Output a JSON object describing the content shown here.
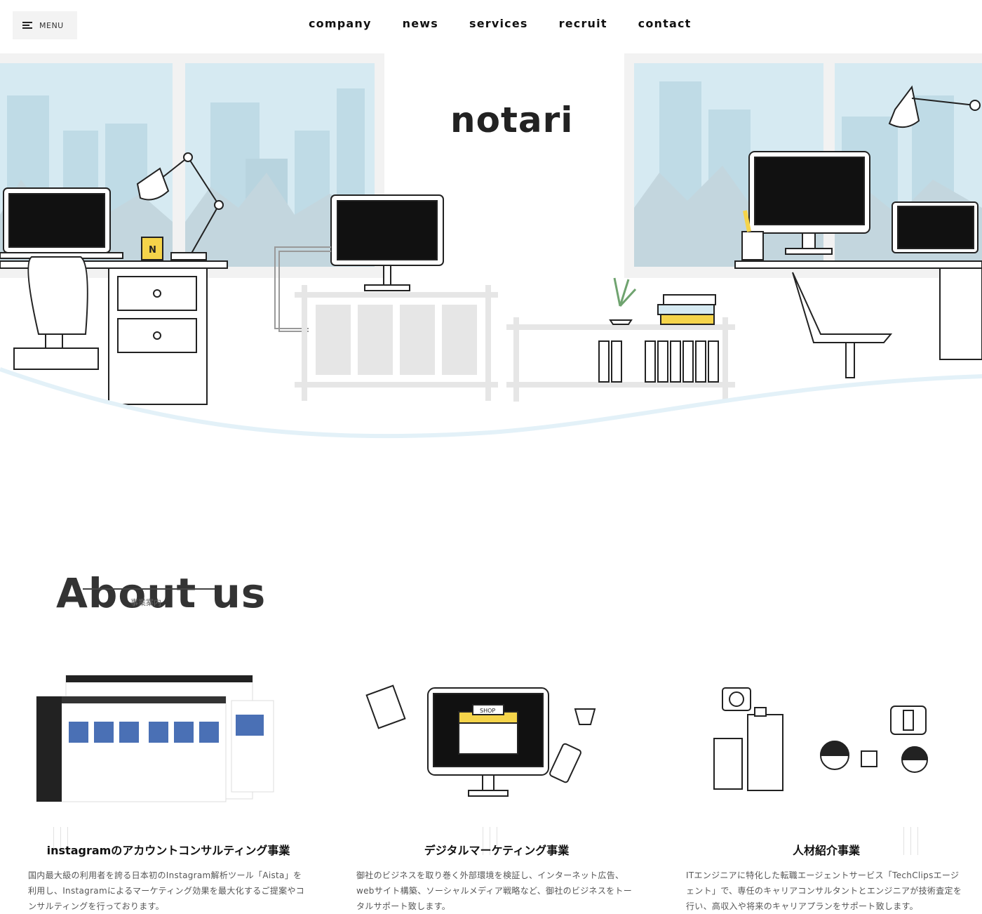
{
  "header": {
    "menu_label": "MENU",
    "nav": [
      "company",
      "news",
      "services",
      "recruit",
      "contact"
    ]
  },
  "hero": {
    "logo": "notari",
    "mug_letter": "N",
    "shop_sign": "SHOP"
  },
  "about": {
    "title": "About us",
    "subtitle": "事業案内"
  },
  "services": [
    {
      "title": "instagramのアカウントコンサルティング事業",
      "desc": "国内最大級の利用者を誇る日本初のInstagram解析ツール「Aista」を利用し、Instagramによるマーケティング効果を最大化するご提案やコンサルティングを行っております。"
    },
    {
      "title": "デジタルマーケティング事業",
      "desc": "御社のビジネスを取り巻く外部環境を検証し、インターネット広告、webサイト構築、ソーシャルメディア戦略など、御社のビジネスをトータルサポート致します。"
    },
    {
      "title": "人材紹介事業",
      "desc": "ITエンジニアに特化した転職エージェントサービス「TechClipsエージェント」で、専任のキャリアコンサルタントとエンジニアが技術査定を行い、高収入や将来のキャリアプランをサポート致します。"
    }
  ],
  "colors": {
    "sky": "#d6eaf2",
    "mountain": "#c3d6de",
    "screen": "#111111",
    "accent_yellow": "#f5d44a",
    "wave": "#e3f1f8"
  }
}
